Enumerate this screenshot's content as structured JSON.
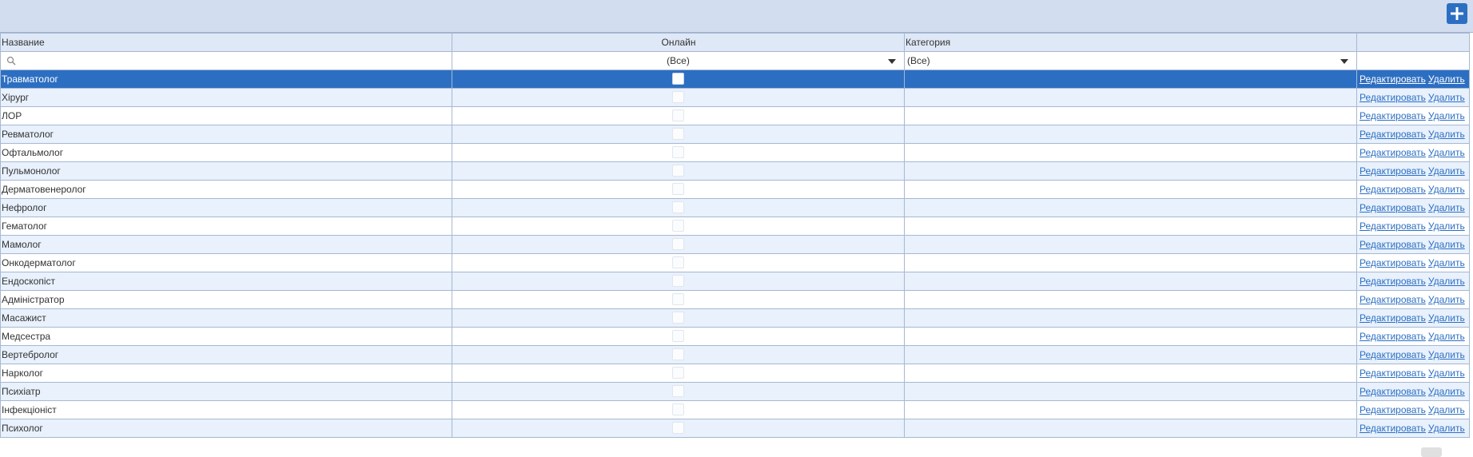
{
  "toolbar": {
    "add_icon": "plus-icon"
  },
  "columns": {
    "name": "Название",
    "online": "Онлайн",
    "category": "Категория",
    "actions": ""
  },
  "filters": {
    "name_value": "",
    "online_value": "(Все)",
    "category_value": "(Все)"
  },
  "actions": {
    "edit": "Редактировать",
    "delete": "Удалить"
  },
  "rows": [
    {
      "name": "Травматолог",
      "online": false,
      "category": "",
      "selected": true
    },
    {
      "name": "Хірург",
      "online": false,
      "category": ""
    },
    {
      "name": "ЛОР",
      "online": false,
      "category": ""
    },
    {
      "name": "Ревматолог",
      "online": false,
      "category": ""
    },
    {
      "name": "Офтальмолог",
      "online": false,
      "category": ""
    },
    {
      "name": "Пульмонолог",
      "online": false,
      "category": ""
    },
    {
      "name": "Дерматовенеролог",
      "online": false,
      "category": ""
    },
    {
      "name": "Нефролог",
      "online": false,
      "category": ""
    },
    {
      "name": "Гематолог",
      "online": false,
      "category": ""
    },
    {
      "name": "Мамолог",
      "online": false,
      "category": ""
    },
    {
      "name": "Онкодерматолог",
      "online": false,
      "category": ""
    },
    {
      "name": "Ендоскопіст",
      "online": false,
      "category": ""
    },
    {
      "name": "Адміністратор",
      "online": false,
      "category": ""
    },
    {
      "name": "Масажист",
      "online": false,
      "category": ""
    },
    {
      "name": "Медсестра",
      "online": false,
      "category": ""
    },
    {
      "name": "Вертебролог",
      "online": false,
      "category": ""
    },
    {
      "name": "Нарколог",
      "online": false,
      "category": ""
    },
    {
      "name": "Психіатр",
      "online": false,
      "category": ""
    },
    {
      "name": "Інфекціоніст",
      "online": false,
      "category": ""
    },
    {
      "name": "Психолог",
      "online": false,
      "category": ""
    }
  ],
  "colors": {
    "header_bg": "#d2deef",
    "accent": "#2c6fc2",
    "row_alt": "#e8f1fc"
  }
}
